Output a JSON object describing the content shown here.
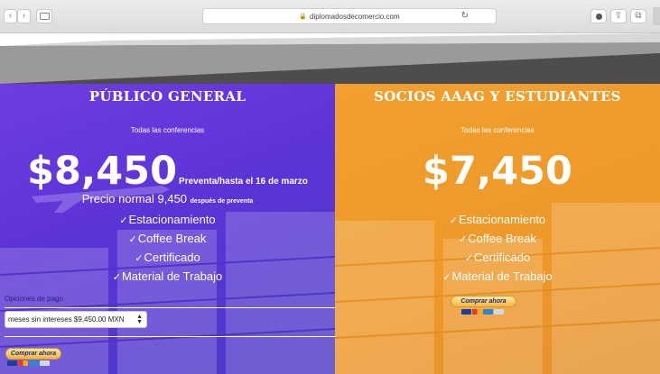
{
  "browser": {
    "url": "diplomadosdecomercio.com",
    "back_icon": "chevron-left-icon",
    "forward_icon": "chevron-right-icon",
    "sidebar_icon": "sidebar-icon",
    "reload_icon": "reload-icon",
    "download_icon": "download-icon",
    "share_icon": "share-icon",
    "tabs_icon": "tabs-icon"
  },
  "plans": [
    {
      "title": "PÚBLICO GENERAL",
      "subtitle": "Todas las conferencias",
      "price": "$8,450",
      "presale": "Preventa/hasta el 16 de marzo",
      "normal_prefix": "Precio normal 9,450",
      "normal_suffix": "después de preventa",
      "features": [
        "Estacionamiento",
        "Coffee Break",
        "Certificado",
        "Material de Trabajo"
      ],
      "payment_label": "Opciones de pago",
      "payment_selected": "meses sin intereses $9,450.00 MXN",
      "buy_label": "Comprar ahora"
    },
    {
      "title": "SOCIOS AAAG Y ESTUDIANTES",
      "subtitle": "Todas las conferencias",
      "price": "$7,450",
      "features": [
        "Estacionamiento",
        "Coffee Break",
        "Certificado",
        "Material de Trabajo"
      ],
      "buy_label": "Comprar ahora"
    }
  ],
  "colors": {
    "left_bg": "#5c33d6",
    "right_bg": "#ee9829",
    "button_gold": "#f7b53d"
  }
}
